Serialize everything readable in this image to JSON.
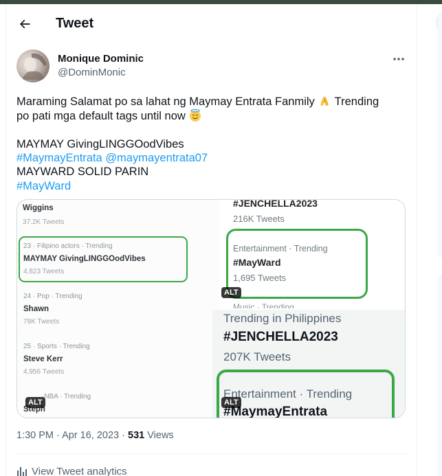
{
  "colors": {
    "accent": "#1d9bf0",
    "highlight_green": "#3aa845",
    "text_primary": "#0f1419",
    "text_secondary": "#536471"
  },
  "header": {
    "title": "Tweet",
    "back_icon": "arrow-left-icon"
  },
  "author": {
    "display_name": "Monique Dominic",
    "handle": "@DominMonic"
  },
  "tweet": {
    "line1": "Maraming Salamat po sa lahat ng Maymay Entrata Fanmily",
    "line1_tail": "Trending",
    "line2": "po pati mga default tags until now",
    "line3": "MAYMAY GivingLINGGOodVibes",
    "line4_tag": "#MaymayEntrata",
    "line4_mention": "@maymayentrata07",
    "line5": "MAYWARD SOLID PARIN",
    "line6_tag": "#MayWard",
    "emoji1": "folded-hands-emoji",
    "emoji2": "smiling-face-with-halo-emoji"
  },
  "media": {
    "left_image": {
      "rows": [
        {
          "title": "Wiggins",
          "count": "37.2K Tweets"
        },
        {
          "meta": "23 · Filipino actors · Trending",
          "title": "MAYMAY GivingLINGGOodVibes",
          "count": "4,823 Tweets"
        },
        {
          "meta": "24 · Pop · Trending",
          "title": "Shawn",
          "count": "79K Tweets"
        },
        {
          "meta": "25 · Sports · Trending",
          "title": "Steve Kerr",
          "count": "4,956 Tweets"
        },
        {
          "meta": "·NBA · Trending",
          "title": "Steph"
        }
      ],
      "alt": "ALT"
    },
    "top_right_image": {
      "title": "#JENCHELLA2023",
      "count": "216K Tweets",
      "meta": "Entertainment · Trending",
      "tag": "#MayWard",
      "tag_count": "1,695 Tweets",
      "peek": "Music · Trending",
      "alt": "ALT"
    },
    "bottom_right_image": {
      "header": "Trending in Philippines",
      "title": "#JENCHELLA2023",
      "count": "207K Tweets",
      "meta": "Entertainment · Trending",
      "tag": "#MaymayEntrata",
      "alt": "ALT"
    }
  },
  "meta": {
    "time": "1:30 PM · Apr 16, 2023 · ",
    "views_count": "531",
    "views_label": " Views"
  },
  "analytics": {
    "label": "View Tweet analytics",
    "icon": "bar-chart-icon"
  }
}
